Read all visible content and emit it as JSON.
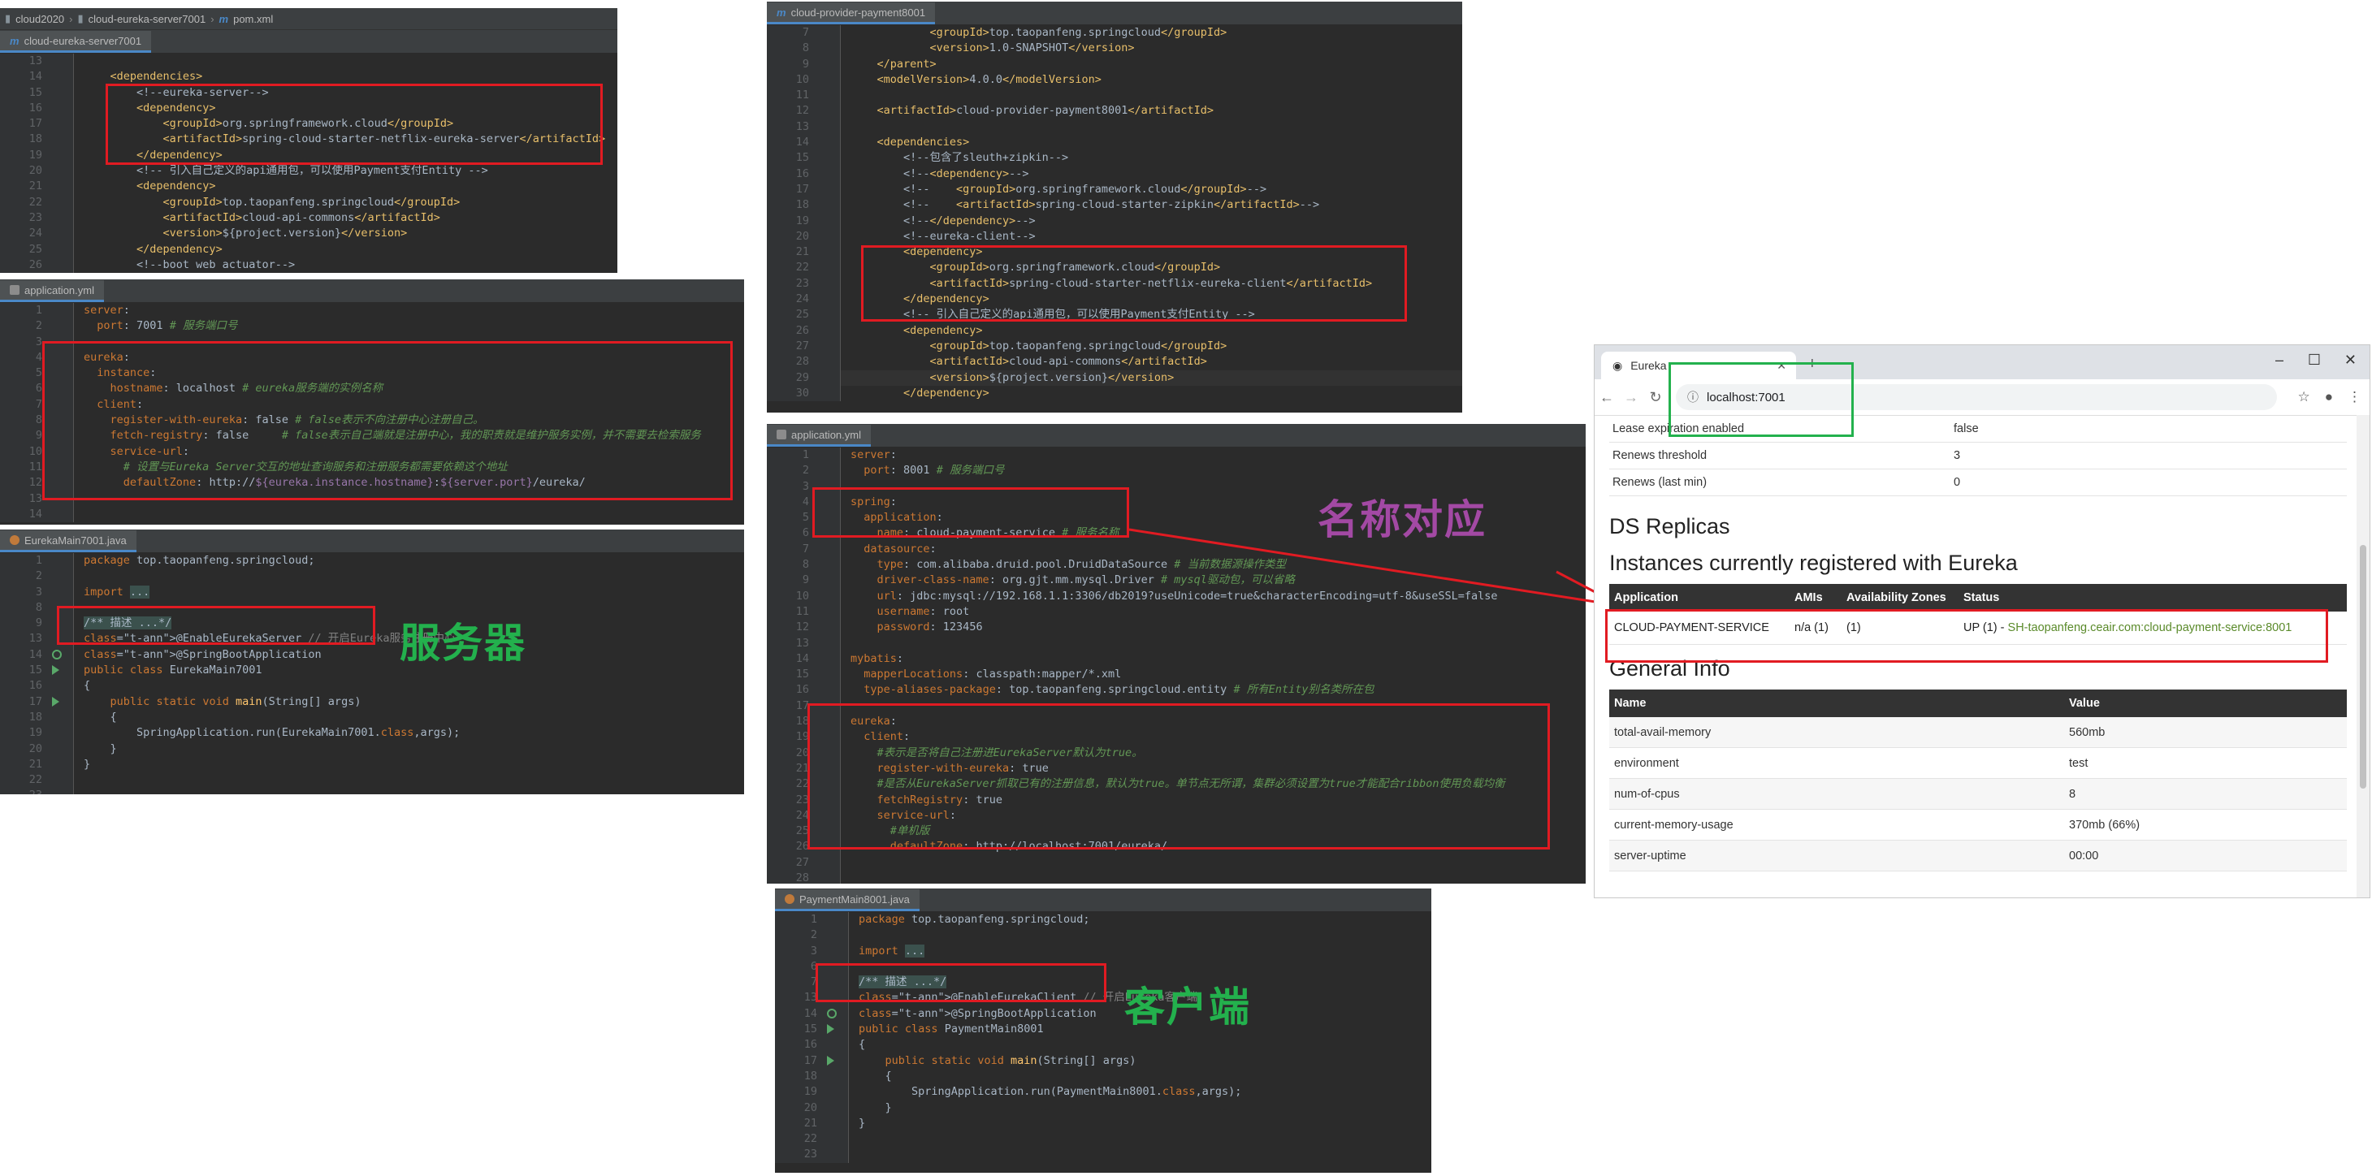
{
  "panel_server_pom": {
    "breadcrumbs": [
      "cloud2020",
      "cloud-eureka-server7001",
      "pom.xml"
    ],
    "tab": "cloud-eureka-server7001",
    "lines": [
      {
        "n": "13",
        "t": ""
      },
      {
        "n": "14",
        "t": "    <dependencies>"
      },
      {
        "n": "15",
        "t": "        <!--eureka-server-->"
      },
      {
        "n": "16",
        "t": "        <dependency>"
      },
      {
        "n": "17",
        "t": "            <groupId>org.springframework.cloud</groupId>"
      },
      {
        "n": "18",
        "t": "            <artifactId>spring-cloud-starter-netflix-eureka-server</artifactId>"
      },
      {
        "n": "19",
        "t": "        </dependency>"
      },
      {
        "n": "20",
        "t": "        <!-- 引入自己定义的api通用包，可以使用Payment支付Entity -->"
      },
      {
        "n": "21",
        "t": "        <dependency>"
      },
      {
        "n": "22",
        "t": "            <groupId>top.taopanfeng.springcloud</groupId>"
      },
      {
        "n": "23",
        "t": "            <artifactId>cloud-api-commons</artifactId>"
      },
      {
        "n": "24",
        "t": "            <version>${project.version}</version>"
      },
      {
        "n": "25",
        "t": "        </dependency>"
      },
      {
        "n": "26",
        "t": "        <!--boot web actuator-->"
      }
    ]
  },
  "panel_server_yml": {
    "tab": "application.yml",
    "lines": [
      {
        "n": "1",
        "t": "server:"
      },
      {
        "n": "2",
        "t": "  port: 7001 # 服务端口号"
      },
      {
        "n": "3",
        "t": ""
      },
      {
        "n": "4",
        "t": "eureka:"
      },
      {
        "n": "5",
        "t": "  instance:"
      },
      {
        "n": "6",
        "t": "    hostname: localhost # eureka服务端的实例名称"
      },
      {
        "n": "7",
        "t": "  client:"
      },
      {
        "n": "8",
        "t": "    register-with-eureka: false # false表示不向注册中心注册自己。"
      },
      {
        "n": "9",
        "t": "    fetch-registry: false     # false表示自己端就是注册中心，我的职责就是维护服务实例，并不需要去检索服务"
      },
      {
        "n": "10",
        "t": "    service-url:"
      },
      {
        "n": "11",
        "t": "      # 设置与Eureka Server交互的地址查询服务和注册服务都需要依赖这个地址"
      },
      {
        "n": "12",
        "t": "      defaultZone: http://${eureka.instance.hostname}:${server.port}/eureka/"
      },
      {
        "n": "13",
        "t": ""
      },
      {
        "n": "14",
        "t": ""
      }
    ]
  },
  "panel_server_main": {
    "tab": "EurekaMain7001.java",
    "lines": [
      {
        "n": "1",
        "t": "package top.taopanfeng.springcloud;"
      },
      {
        "n": "2",
        "t": ""
      },
      {
        "n": "3",
        "t": "import ..."
      },
      {
        "n": "8",
        "t": ""
      },
      {
        "n": "9",
        "t": "/** 描述 ...*/"
      },
      {
        "n": "13",
        "t": "@EnableEurekaServer // 开启Eureka服务注册中心"
      },
      {
        "n": "14",
        "t": "@SpringBootApplication"
      },
      {
        "n": "15",
        "t": "public class EurekaMain7001"
      },
      {
        "n": "16",
        "t": "{"
      },
      {
        "n": "17",
        "t": "    public static void main(String[] args)"
      },
      {
        "n": "18",
        "t": "    {"
      },
      {
        "n": "19",
        "t": "        SpringApplication.run(EurekaMain7001.class,args);"
      },
      {
        "n": "20",
        "t": "    }"
      },
      {
        "n": "21",
        "t": "}"
      },
      {
        "n": "22",
        "t": ""
      },
      {
        "n": "23",
        "t": ""
      }
    ]
  },
  "panel_client_pom": {
    "tab": "cloud-provider-payment8001",
    "lines": [
      {
        "n": "7",
        "t": "            <groupId>top.taopanfeng.springcloud</groupId>"
      },
      {
        "n": "8",
        "t": "            <version>1.0-SNAPSHOT</version>"
      },
      {
        "n": "9",
        "t": "    </parent>"
      },
      {
        "n": "10",
        "t": "    <modelVersion>4.0.0</modelVersion>"
      },
      {
        "n": "11",
        "t": ""
      },
      {
        "n": "12",
        "t": "    <artifactId>cloud-provider-payment8001</artifactId>"
      },
      {
        "n": "13",
        "t": ""
      },
      {
        "n": "14",
        "t": "    <dependencies>"
      },
      {
        "n": "15",
        "t": "        <!--包含了sleuth+zipkin-->"
      },
      {
        "n": "16",
        "t": "        <!--<dependency>-->"
      },
      {
        "n": "17",
        "t": "        <!--    <groupId>org.springframework.cloud</groupId>-->"
      },
      {
        "n": "18",
        "t": "        <!--    <artifactId>spring-cloud-starter-zipkin</artifactId>-->"
      },
      {
        "n": "19",
        "t": "        <!--</dependency>-->"
      },
      {
        "n": "20",
        "t": "        <!--eureka-client-->"
      },
      {
        "n": "21",
        "t": "        <dependency>"
      },
      {
        "n": "22",
        "t": "            <groupId>org.springframework.cloud</groupId>"
      },
      {
        "n": "23",
        "t": "            <artifactId>spring-cloud-starter-netflix-eureka-client</artifactId>"
      },
      {
        "n": "24",
        "t": "        </dependency>"
      },
      {
        "n": "25",
        "t": "        <!-- 引入自己定义的api通用包，可以使用Payment支付Entity -->"
      },
      {
        "n": "26",
        "t": "        <dependency>"
      },
      {
        "n": "27",
        "t": "            <groupId>top.taopanfeng.springcloud</groupId>"
      },
      {
        "n": "28",
        "t": "            <artifactId>cloud-api-commons</artifactId>"
      },
      {
        "n": "29",
        "t": "            <version>${project.version}</version>"
      },
      {
        "n": "30",
        "t": "        </dependency>"
      }
    ]
  },
  "panel_client_yml": {
    "tab": "application.yml",
    "lines": [
      {
        "n": "1",
        "t": "server:"
      },
      {
        "n": "2",
        "t": "  port: 8001 # 服务端口号"
      },
      {
        "n": "3",
        "t": ""
      },
      {
        "n": "4",
        "t": "spring:"
      },
      {
        "n": "5",
        "t": "  application:"
      },
      {
        "n": "6",
        "t": "    name: cloud-payment-service # 服务名称"
      },
      {
        "n": "7",
        "t": "  datasource:"
      },
      {
        "n": "8",
        "t": "    type: com.alibaba.druid.pool.DruidDataSource # 当前数据源操作类型"
      },
      {
        "n": "9",
        "t": "    driver-class-name: org.gjt.mm.mysql.Driver # mysql驱动包，可以省略"
      },
      {
        "n": "10",
        "t": "    url: jdbc:mysql://192.168.1.1:3306/db2019?useUnicode=true&characterEncoding=utf-8&useSSL=false"
      },
      {
        "n": "11",
        "t": "    username: root"
      },
      {
        "n": "12",
        "t": "    password: 123456"
      },
      {
        "n": "13",
        "t": ""
      },
      {
        "n": "14",
        "t": "mybatis:"
      },
      {
        "n": "15",
        "t": "  mapperLocations: classpath:mapper/*.xml"
      },
      {
        "n": "16",
        "t": "  type-aliases-package: top.taopanfeng.springcloud.entity # 所有Entity别名类所在包"
      },
      {
        "n": "17",
        "t": ""
      },
      {
        "n": "18",
        "t": "eureka:"
      },
      {
        "n": "19",
        "t": "  client:"
      },
      {
        "n": "20",
        "t": "    #表示是否将自己注册进EurekaServer默认为true。"
      },
      {
        "n": "21",
        "t": "    register-with-eureka: true"
      },
      {
        "n": "22",
        "t": "    #是否从EurekaServer抓取已有的注册信息，默认为true。单节点无所谓，集群必须设置为true才能配合ribbon使用负载均衡"
      },
      {
        "n": "23",
        "t": "    fetchRegistry: true"
      },
      {
        "n": "24",
        "t": "    service-url:"
      },
      {
        "n": "25",
        "t": "      #单机版"
      },
      {
        "n": "26",
        "t": "      defaultZone: http://localhost:7001/eureka/"
      },
      {
        "n": "27",
        "t": ""
      },
      {
        "n": "28",
        "t": ""
      }
    ]
  },
  "panel_client_main": {
    "tab": "PaymentMain8001.java",
    "lines": [
      {
        "n": "1",
        "t": "package top.taopanfeng.springcloud;"
      },
      {
        "n": "2",
        "t": ""
      },
      {
        "n": "3",
        "t": "import ..."
      },
      {
        "n": "6",
        "t": ""
      },
      {
        "n": "7",
        "t": "/** 描述 ...*/"
      },
      {
        "n": "13",
        "t": "@EnableEurekaClient // 开启Eureka客户端"
      },
      {
        "n": "14",
        "t": "@SpringBootApplication"
      },
      {
        "n": "15",
        "t": "public class PaymentMain8001"
      },
      {
        "n": "16",
        "t": "{"
      },
      {
        "n": "17",
        "t": "    public static void main(String[] args)"
      },
      {
        "n": "18",
        "t": "    {"
      },
      {
        "n": "19",
        "t": "        SpringApplication.run(PaymentMain8001.class,args);"
      },
      {
        "n": "20",
        "t": "    }"
      },
      {
        "n": "21",
        "t": "}"
      },
      {
        "n": "22",
        "t": ""
      },
      {
        "n": "23",
        "t": ""
      }
    ]
  },
  "annotations": {
    "server_label": "服务器",
    "client_label": "客户端",
    "name_match_label": "名称对应",
    "server_color": "#23b14d",
    "client_color": "#23b14d",
    "name_color": "#a349a4",
    "box_color": "#e11b22"
  },
  "browser": {
    "tab_title": "Eureka",
    "url": "localhost:7001",
    "top_rows": [
      {
        "k": "Lease expiration enabled",
        "v": "false"
      },
      {
        "k": "Renews threshold",
        "v": "3"
      },
      {
        "k": "Renews (last min)",
        "v": "0"
      }
    ],
    "ds_replicas": "DS Replicas",
    "instances_title": "Instances currently registered with Eureka",
    "instances_headers": {
      "app": "Application",
      "amis": "AMIs",
      "az": "Availability Zones",
      "status": "Status"
    },
    "instance": {
      "app": "CLOUD-PAYMENT-SERVICE",
      "amis": "n/a (1)",
      "az": "(1)",
      "status_prefix": "UP (1) - ",
      "status_link": "SH-taopanfeng.ceair.com:cloud-payment-service:8001"
    },
    "general_info": "General Info",
    "gi_headers": {
      "name": "Name",
      "value": "Value"
    },
    "gi_rows": [
      {
        "k": "total-avail-memory",
        "v": "560mb"
      },
      {
        "k": "environment",
        "v": "test"
      },
      {
        "k": "num-of-cpus",
        "v": "8"
      },
      {
        "k": "current-memory-usage",
        "v": "370mb (66%)"
      },
      {
        "k": "server-uptime",
        "v": "00:00"
      }
    ]
  }
}
